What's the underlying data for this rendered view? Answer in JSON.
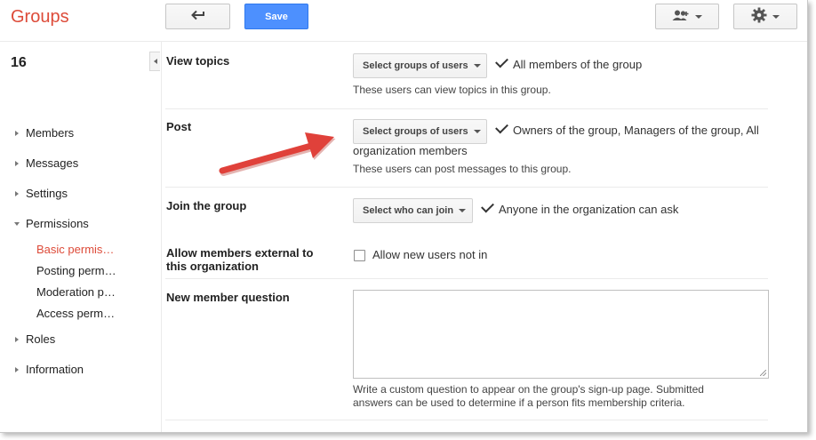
{
  "app": {
    "title": "Groups"
  },
  "toolbar": {
    "save_label": "Save"
  },
  "sidebar": {
    "group_name": "16",
    "items": [
      {
        "label": "Members"
      },
      {
        "label": "Messages"
      },
      {
        "label": "Settings"
      },
      {
        "label": "Permissions"
      },
      {
        "label": "Roles"
      },
      {
        "label": "Information"
      }
    ],
    "sub_items": [
      {
        "label": "Basic permis…"
      },
      {
        "label": "Posting perm…"
      },
      {
        "label": "Moderation p…"
      },
      {
        "label": "Access perm…"
      }
    ]
  },
  "settings": {
    "view_topics": {
      "label": "View topics",
      "select": "Select groups of users",
      "value": "All members of the group",
      "help": "These users can view topics in this group."
    },
    "post": {
      "label": "Post",
      "select": "Select groups of users",
      "value_line1": "Owners of the group, Managers of the group, All",
      "value_line2": "organization members",
      "help": "These users can post messages to this group."
    },
    "join": {
      "label": "Join the group",
      "select": "Select who can join",
      "value": "Anyone in the organization can ask"
    },
    "external": {
      "label_line1": "Allow members external to",
      "label_line2": "this organization",
      "checkbox_label": "Allow new users not in"
    },
    "question": {
      "label": "New member question",
      "help_line1": "Write a custom question to appear on the group's sign-up page. Submitted",
      "help_line2": "answers can be used to determine if a person fits membership criteria."
    }
  },
  "colors": {
    "brand": "#dd4b39",
    "primary_button": "#4d90fe",
    "annotation_arrow": "#e0413a"
  }
}
